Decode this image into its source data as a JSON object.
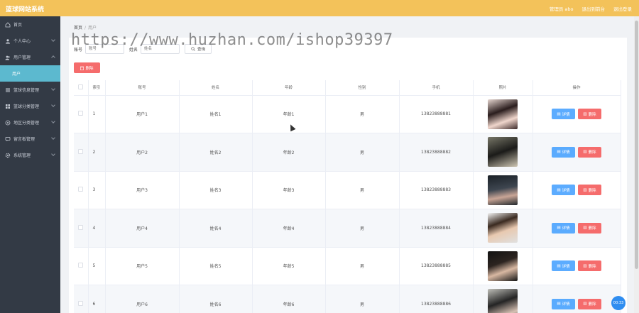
{
  "app": {
    "title": "篮球网站系统",
    "header_links": [
      "管理员 abo",
      "退出到前台",
      "退出登录"
    ]
  },
  "sidebar": {
    "items": [
      {
        "label": "首页",
        "icon": "home-icon"
      },
      {
        "label": "个人中心",
        "icon": "user-icon"
      },
      {
        "label": "用户管理",
        "icon": "users-icon"
      },
      {
        "label": "用户",
        "icon": ""
      },
      {
        "label": "篮球信息管理",
        "icon": "list-icon"
      },
      {
        "label": "篮球分类管理",
        "icon": "grid-icon"
      },
      {
        "label": "地区分类管理",
        "icon": "location-icon"
      },
      {
        "label": "留言板管理",
        "icon": "message-icon"
      },
      {
        "label": "系统管理",
        "icon": "settings-icon"
      }
    ]
  },
  "breadcrumb": {
    "home": "首页",
    "sep": "/",
    "current": "用户"
  },
  "filters": {
    "account_label": "账号",
    "account_placeholder": "账号",
    "name_label": "姓名",
    "name_placeholder": "姓名",
    "query_label": "查询"
  },
  "delete_label": "删除",
  "table": {
    "headers": [
      "索引",
      "账号",
      "姓名",
      "年龄",
      "性别",
      "手机",
      "照片",
      "操作"
    ],
    "rows": [
      {
        "index": "1",
        "account": "用户1",
        "name": "姓名1",
        "age": "年龄1",
        "gender": "男",
        "phone": "13823888881"
      },
      {
        "index": "2",
        "account": "用户2",
        "name": "姓名2",
        "age": "年龄2",
        "gender": "男",
        "phone": "13823888882"
      },
      {
        "index": "3",
        "account": "用户3",
        "name": "姓名3",
        "age": "年龄3",
        "gender": "男",
        "phone": "13823888883"
      },
      {
        "index": "4",
        "account": "用户4",
        "name": "姓名4",
        "age": "年龄4",
        "gender": "男",
        "phone": "13823888884"
      },
      {
        "index": "5",
        "account": "用户5",
        "name": "姓名5",
        "age": "年龄5",
        "gender": "男",
        "phone": "13823888885"
      },
      {
        "index": "6",
        "account": "用户6",
        "name": "姓名6",
        "age": "年龄6",
        "gender": "男",
        "phone": "13823888886"
      }
    ],
    "detail_label": "详情",
    "delete_label": "删除"
  },
  "watermark": "https://www.huzhan.com/ishop39397",
  "timer": "00:33",
  "colors": {
    "header": "#f3c25a",
    "sidebar": "#333a45",
    "sidebar_active": "#5cb9cf",
    "danger": "#f56c6c",
    "primary": "#409eff"
  }
}
